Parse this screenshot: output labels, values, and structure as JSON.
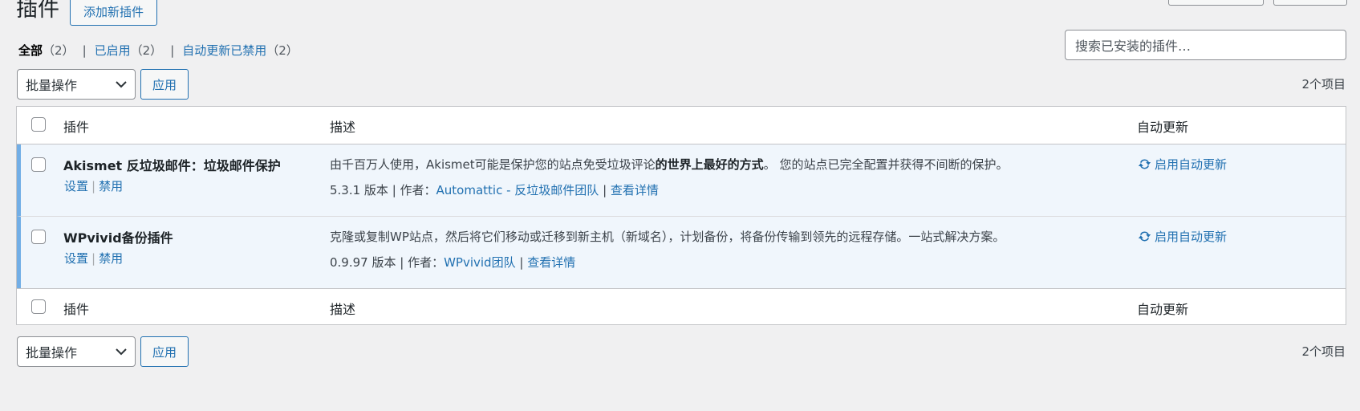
{
  "header": {
    "title": "插件",
    "add_button": "添加新插件"
  },
  "filters": [
    {
      "label": "全部",
      "count": "（2）"
    },
    {
      "label": "已启用",
      "count": "（2）"
    },
    {
      "label": "自动更新已禁用",
      "count": "（2）"
    }
  ],
  "search": {
    "placeholder": "搜索已安装的插件…"
  },
  "bulk": {
    "select_label": "批量操作",
    "apply_label": "应用",
    "items_count": "2个项目"
  },
  "columns": {
    "plugin": "插件",
    "description": "描述",
    "auto_update": "自动更新"
  },
  "plugins": [
    {
      "name": "Akismet 反垃圾邮件：垃圾邮件保护",
      "actions": {
        "settings": "设置",
        "deactivate": "禁用"
      },
      "desc_pre": "由千百万人使用，Akismet可能是保护您的站点免受垃圾评论",
      "desc_bold": "的世界上最好的方式",
      "desc_post": "。 您的站点已完全配置并获得不间断的保护。",
      "version": "5.3.1 版本 | 作者：",
      "author": "Automattic - 反垃圾邮件团队",
      "details": "查看详情",
      "auto_update": "启用自动更新"
    },
    {
      "name": "WPvivid备份插件",
      "actions": {
        "settings": "设置",
        "deactivate": "禁用"
      },
      "desc": "克隆或复制WP站点，然后将它们移动或迁移到新主机（新域名），计划备份，将备份传输到领先的远程存储。一站式解决方案。",
      "version": "0.9.97 版本 | 作者：",
      "author": "WPvivid团队",
      "details": "查看详情",
      "auto_update": "启用自动更新"
    }
  ],
  "separator": "|",
  "colors": {
    "link": "#2271b1",
    "active_row_bg": "#f0f6fc",
    "active_row_border": "#72aee6",
    "background": "#f0f0f1"
  }
}
